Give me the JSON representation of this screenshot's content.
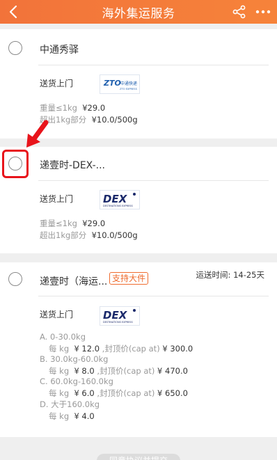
{
  "header": {
    "title": "海外集运服务"
  },
  "options": [
    {
      "name": "中通秀驿",
      "delivery": "送货上门",
      "logo_name": "ZTO",
      "logo_cn": "中通快递",
      "logo_en": "ZTO EXPRESS",
      "price_lines": [
        {
          "label": "重量≤1kg",
          "value": "¥29.0"
        },
        {
          "label": "超出1kg部分",
          "value": "¥10.0/500g"
        }
      ]
    },
    {
      "name": "递壹时-DEX-...",
      "delivery": "送货上门",
      "logo_name": "DEX",
      "logo_sub": "DESTINATIONS EXPRESS",
      "price_lines": [
        {
          "label": "重量≤1kg",
          "value": "¥29.0"
        },
        {
          "label": "超出1kg部分",
          "value": "¥10.0/500g"
        }
      ]
    },
    {
      "name": "递壹时（海运...",
      "badge": "支持大件",
      "time_label": "运送时间: 14-25天",
      "delivery": "送货上门",
      "logo_name": "DEX",
      "logo_sub": "DESTINATIONS EXPRESS",
      "tiers": [
        {
          "range": "A. 0-30.0kg",
          "unit": "每 kg",
          "price": "¥ 12.0",
          "cap_label": ",封顶价(cap at)",
          "cap": "¥ 300.0"
        },
        {
          "range": "B. 30.0kg-60.0kg",
          "unit": "每 kg",
          "price": "¥ 8.0",
          "cap_label": ",封顶价(cap at)",
          "cap": "¥ 470.0"
        },
        {
          "range": "C. 60.0kg-160.0kg",
          "unit": "每 kg",
          "price": "¥ 6.0",
          "cap_label": ",封顶价(cap at)",
          "cap": "¥ 650.0"
        },
        {
          "range": "D. 大于160.0kg",
          "unit": "每 kg",
          "price": "¥ 4.0"
        }
      ]
    }
  ],
  "bottom": {
    "label": "同意协议并提交"
  },
  "colors": {
    "accent": "#f4793a",
    "highlight": "#e8141b",
    "badge": "#ef6b2e"
  }
}
